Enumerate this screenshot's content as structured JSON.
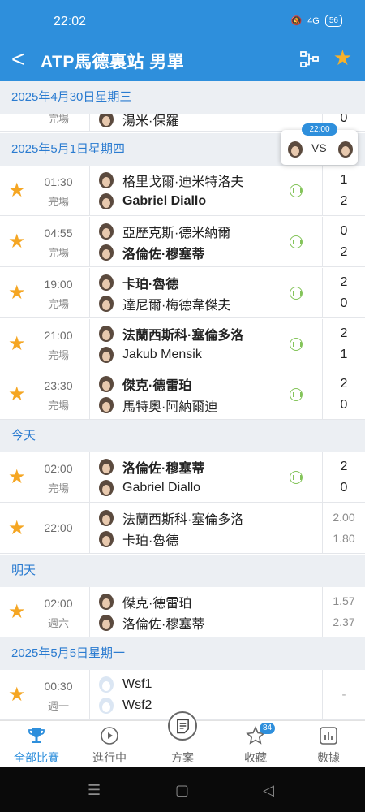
{
  "status": {
    "time": "22:02",
    "network": "4G",
    "battery": "56"
  },
  "header": {
    "back": "<",
    "title": "ATP馬德裏站 男單"
  },
  "sections": {
    "d1": "2025年4月30日星期三",
    "d2": "2025年5月1日星期四",
    "today": "今天",
    "tomorrow": "明天",
    "d5": "2025年5月5日星期一"
  },
  "partial_row": {
    "p2": "湯米·保羅",
    "s2": "0"
  },
  "vs_card": {
    "time": "22:00",
    "label": "VS"
  },
  "matches": [
    {
      "time": "01:30",
      "status": "完場",
      "p1": "格里戈爾·迪米特洛夫",
      "p2": "Gabriel Diallo",
      "s1": "1",
      "s2": "2"
    },
    {
      "time": "04:55",
      "status": "完場",
      "p1": "亞歷克斯·德米納爾",
      "p2": "洛倫佐·穆塞蒂",
      "s1": "0",
      "s2": "2"
    },
    {
      "time": "19:00",
      "status": "完場",
      "p1": "卡珀·魯德",
      "p2": "達尼爾·梅德韋傑夫",
      "s1": "2",
      "s2": "0"
    },
    {
      "time": "21:00",
      "status": "完場",
      "p1": "法蘭西斯科·塞倫多洛",
      "p2": "Jakub Mensik",
      "s1": "2",
      "s2": "1"
    },
    {
      "time": "23:30",
      "status": "完場",
      "p1": "傑克·德雷珀",
      "p2": "馬特奧·阿納爾迪",
      "s1": "2",
      "s2": "0"
    },
    {
      "time": "02:00",
      "status": "完場",
      "p1": "洛倫佐·穆塞蒂",
      "p2": "Gabriel Diallo",
      "s1": "2",
      "s2": "0"
    },
    {
      "time": "22:00",
      "status": "",
      "p1": "法蘭西斯科·塞倫多洛",
      "p2": "卡珀·魯德",
      "s1": "2.00",
      "s2": "1.80"
    },
    {
      "time": "02:00",
      "status": "週六",
      "p1": "傑克·德雷珀",
      "p2": "洛倫佐·穆塞蒂",
      "s1": "1.57",
      "s2": "2.37"
    },
    {
      "time": "00:30",
      "status": "週一",
      "p1": "Wsf1",
      "p2": "Wsf2",
      "dash": "-"
    }
  ],
  "nav": {
    "all": "全部比賽",
    "live": "進行中",
    "plan": "方案",
    "fav": "收藏",
    "fav_count": "84",
    "data": "數據"
  },
  "colors": {
    "primary": "#2e8fdc",
    "star": "#f5a623",
    "live": "#84c45a"
  }
}
